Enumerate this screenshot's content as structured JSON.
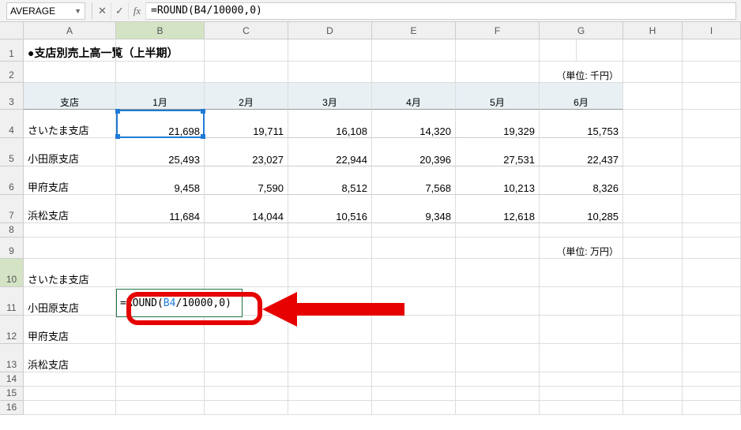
{
  "formula_bar": {
    "name_box": "AVERAGE",
    "cancel": "✕",
    "confirm": "✓",
    "fx": "fx",
    "formula": "=ROUND(B4/10000,0)"
  },
  "cols": [
    "A",
    "B",
    "C",
    "D",
    "E",
    "F",
    "G",
    "H",
    "I"
  ],
  "rows": [
    "1",
    "2",
    "3",
    "4",
    "5",
    "6",
    "7",
    "8",
    "9",
    "10",
    "11",
    "12",
    "13",
    "14",
    "15",
    "16"
  ],
  "title": "●支店別売上高一覧（上半期）",
  "unit_thousand": "（単位: 千円）",
  "unit_tenthousand": "（単位: 万円）",
  "headers": {
    "store": "支店",
    "m1": "1月",
    "m2": "2月",
    "m3": "3月",
    "m4": "4月",
    "m5": "5月",
    "m6": "6月"
  },
  "stores": {
    "s1": "さいたま支店",
    "s2": "小田原支店",
    "s3": "甲府支店",
    "s4": "浜松支店"
  },
  "data": {
    "s1": {
      "m1": "21,698",
      "m2": "19,711",
      "m3": "16,108",
      "m4": "14,320",
      "m5": "19,329",
      "m6": "15,753"
    },
    "s2": {
      "m1": "25,493",
      "m2": "23,027",
      "m3": "22,944",
      "m4": "20,396",
      "m5": "27,531",
      "m6": "22,437"
    },
    "s3": {
      "m1": "9,458",
      "m2": "7,590",
      "m3": "8,512",
      "m4": "7,568",
      "m5": "10,213",
      "m6": "8,326"
    },
    "s4": {
      "m1": "11,684",
      "m2": "14,044",
      "m3": "10,516",
      "m4": "9,348",
      "m5": "12,618",
      "m6": "10,285"
    }
  },
  "edit": {
    "prefix": "=ROUND(",
    "ref": "B4",
    "suffix": "/10000,0)"
  }
}
